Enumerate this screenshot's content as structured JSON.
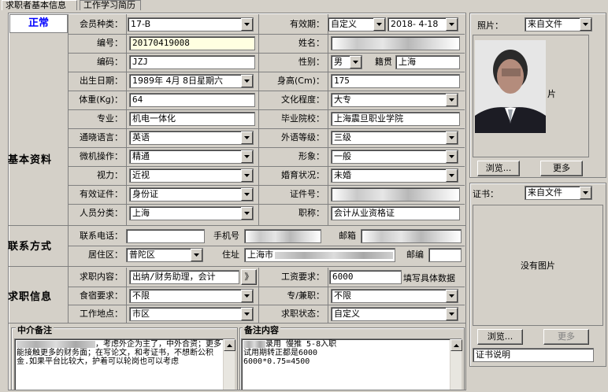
{
  "tabs": [
    "求职者基本信息",
    "工作学习简历"
  ],
  "status": "正常",
  "sections": {
    "basic": "基本资料",
    "contact": "联系方式",
    "job": "求职信息"
  },
  "labels": {
    "member_type": "会员种类：",
    "valid": "有效期：",
    "number": "编号：",
    "name": "姓名：",
    "code": "编码：",
    "gender": "性别：",
    "native": "籍贯",
    "birth": "出生日期：",
    "height": "身高(Cm)：",
    "weight": "体重(Kg)：",
    "education": "文化程度：",
    "major": "专业：",
    "school": "毕业院校：",
    "language": "通晓语言：",
    "foreign_level": "外语等级：",
    "computer": "微机操作：",
    "image": "形象：",
    "vision": "视力：",
    "marriage": "婚育状况：",
    "id_doc": "有效证件：",
    "id_no": "证件号：",
    "category": "人员分类：",
    "title": "职称：",
    "phone": "联系电话：",
    "mobile": "手机号",
    "email": "邮箱",
    "district": "居住区：",
    "address": "住址",
    "zip": "邮编",
    "job_content": "求职内容：",
    "salary": "工资要求：",
    "board": "食宿要求：",
    "parttime": "专/兼职：",
    "location": "工作地点：",
    "job_status": "求职状态："
  },
  "values": {
    "member_type": "17-B",
    "valid_type": "自定义",
    "valid_date": "2018- 4-18",
    "number": "20170419008",
    "code": "JZJ",
    "gender": "男",
    "native": "上海",
    "birth": "1989年 4月 8日星期六",
    "height": "175",
    "weight": "64",
    "education": "大专",
    "major": "机电一体化",
    "school": "上海震旦职业学院",
    "language": "英语",
    "foreign_level": "三级",
    "computer": "精通",
    "image": "一般",
    "vision": "近视",
    "marriage": "未婚",
    "id_doc": "身份证",
    "category": "上海",
    "title": "会计从业资格证",
    "district": "普陀区",
    "address": "上海市",
    "job_content": "出纳/财务助理，会计",
    "salary": "6000",
    "salary_note": "填写具体数据",
    "board": "不限",
    "parttime": "不限",
    "location": "市区",
    "job_status": "自定义"
  },
  "buttons": {
    "more_arrow": "》",
    "browse": "浏览...",
    "more": "更多"
  },
  "photo": {
    "label": "照片：",
    "source": "来自文件",
    "side_char": "片"
  },
  "cert": {
    "label": "证书：",
    "source": "来自文件",
    "empty": "没有图片",
    "desc": "证书说明"
  },
  "memo": {
    "agent_title": "中介备注",
    "agent_text": "，考虑外企为主了，中外合资；更多能接触更多的财务面；在写论文，和考证书，不想断公积金.如果平台比较大，护着可以轮岗也可以考虑",
    "note_title": "备注内容",
    "note_text_1": "录用  慢推   5-8入职",
    "note_text_2": "试用期转正都是6000",
    "note_text_3": "6000*0.75=4500"
  }
}
